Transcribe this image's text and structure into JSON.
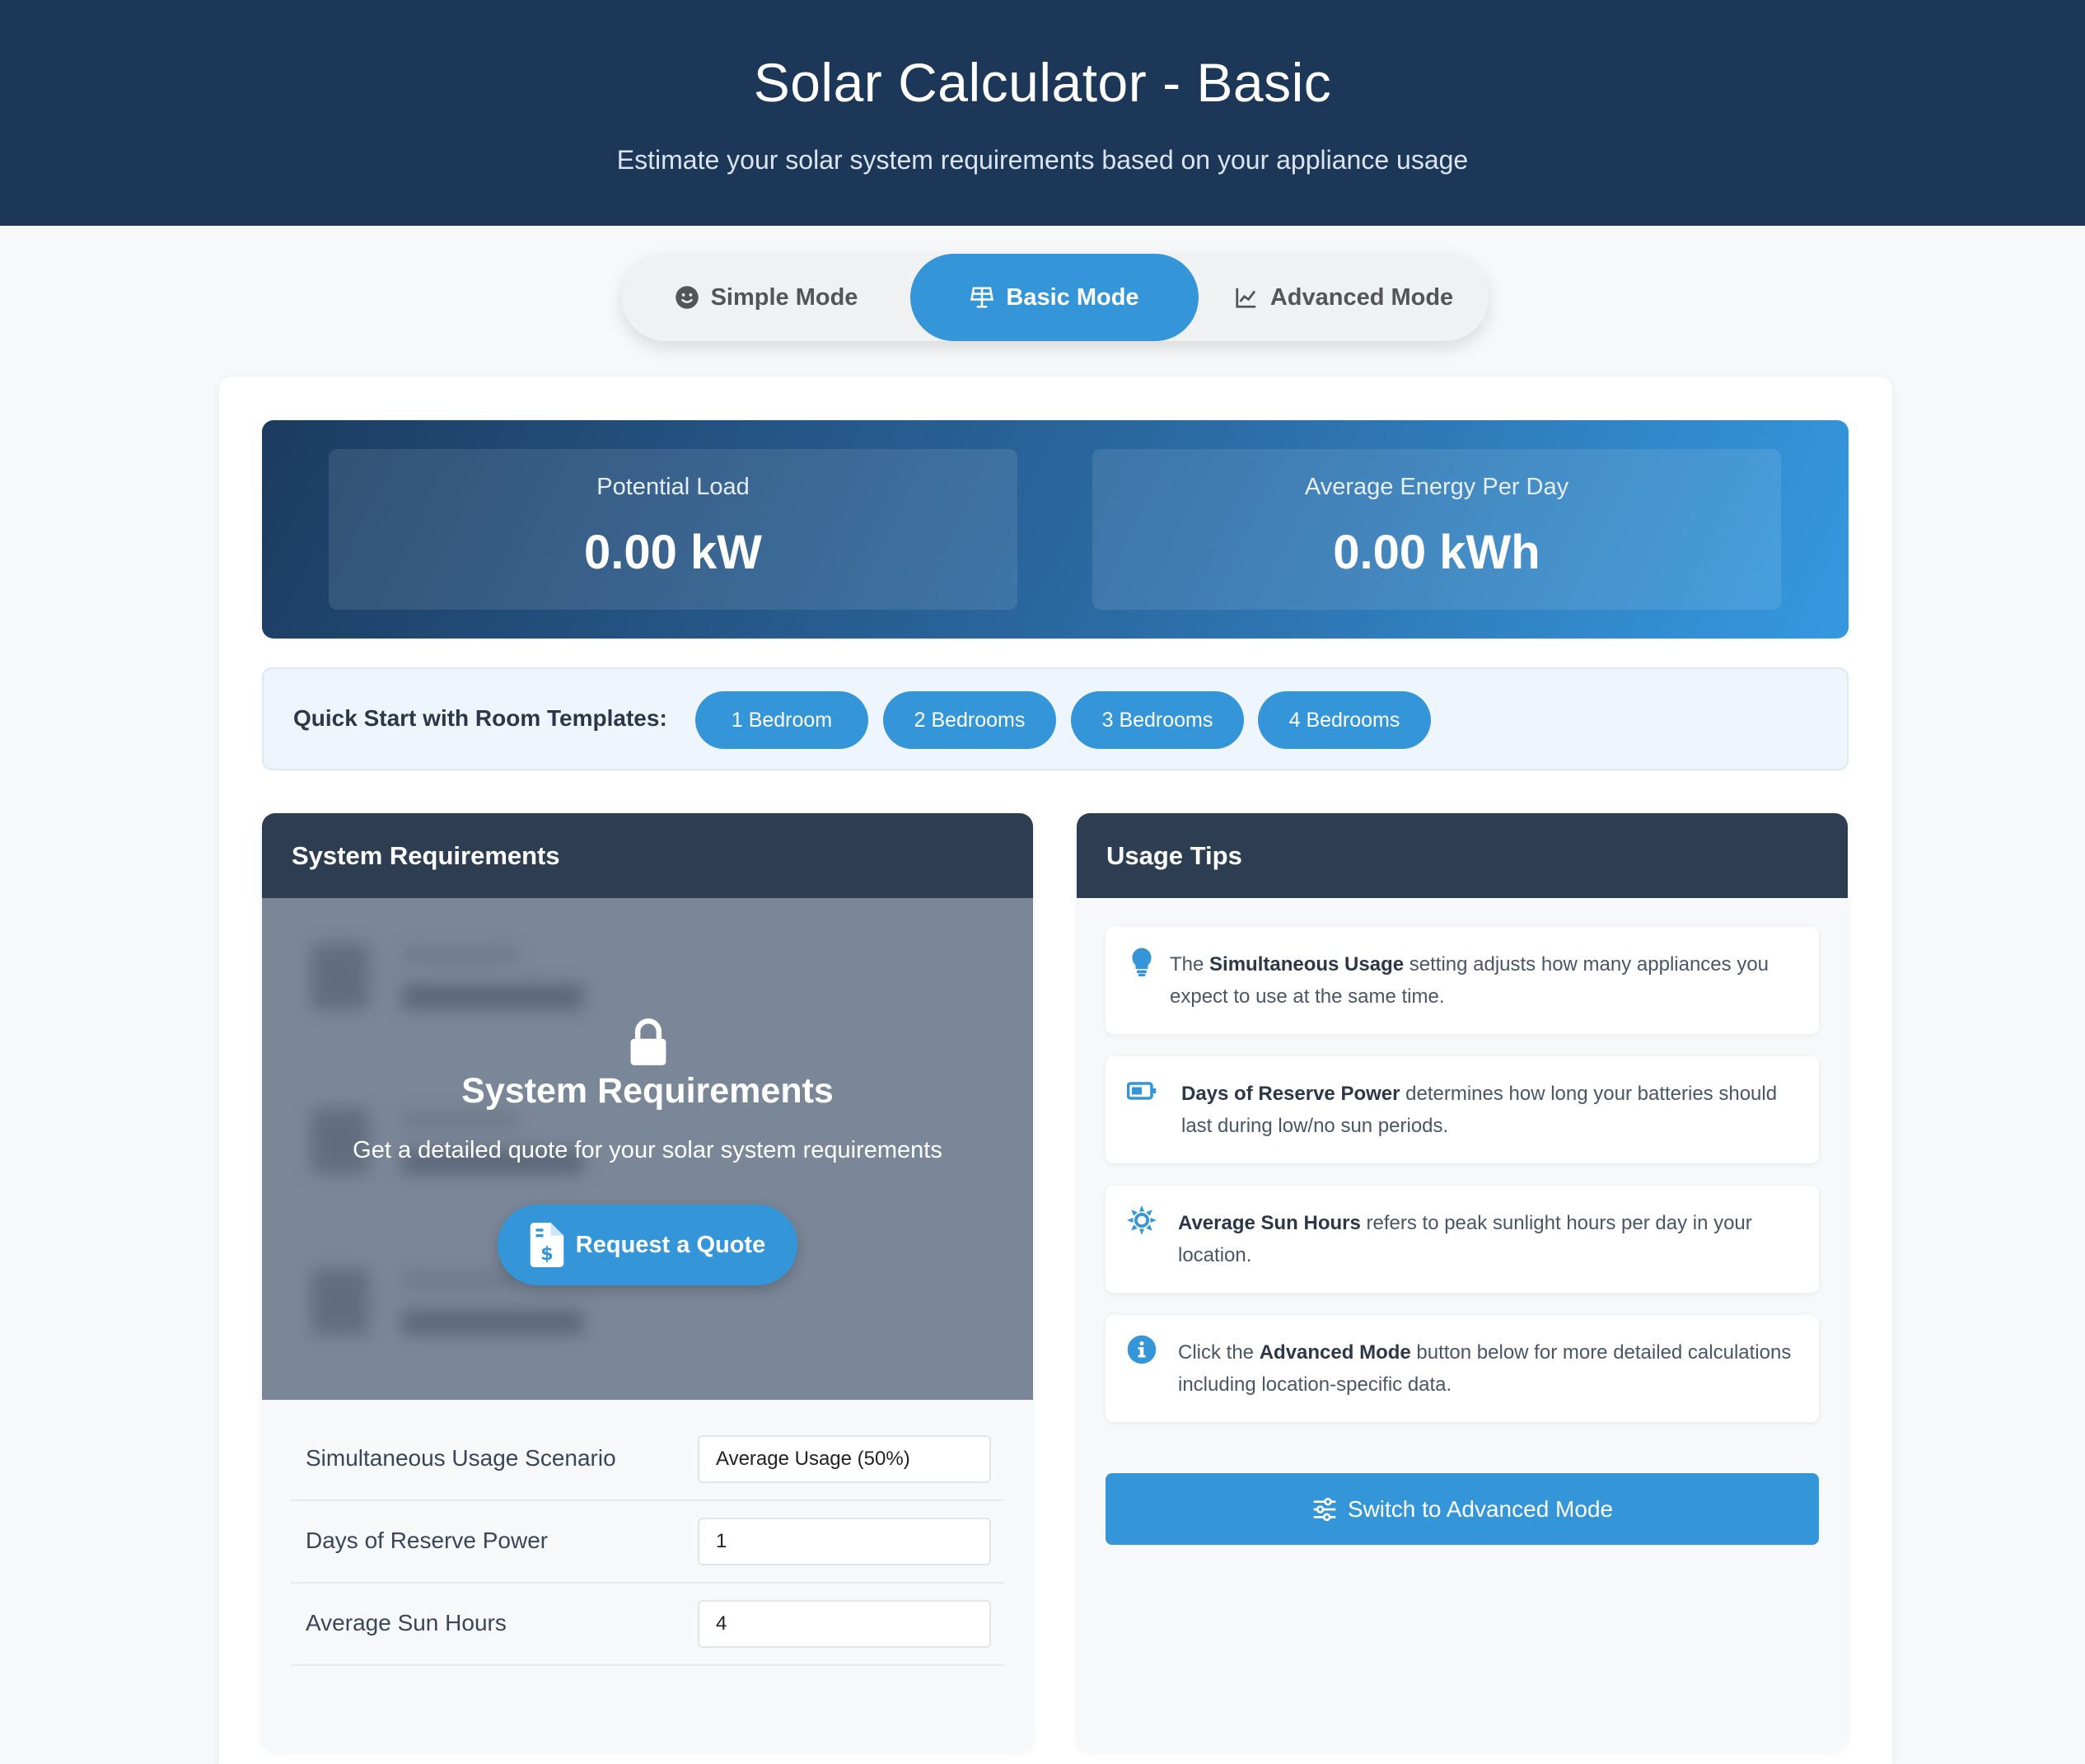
{
  "header": {
    "title": "Solar Calculator - Basic",
    "subtitle": "Estimate your solar system requirements based on your appliance usage"
  },
  "modes": {
    "simple": "Simple Mode",
    "basic": "Basic Mode",
    "advanced": "Advanced Mode",
    "active": "basic"
  },
  "stats": {
    "load_label": "Potential Load",
    "load_value": "0.00 kW",
    "energy_label": "Average Energy Per Day",
    "energy_value": "0.00 kWh"
  },
  "templates": {
    "label": "Quick Start with Room Templates:",
    "items": [
      "1 Bedroom",
      "2 Bedrooms",
      "3 Bedrooms",
      "4 Bedrooms"
    ]
  },
  "system": {
    "panel_title": "System Requirements",
    "locked_title": "System Requirements",
    "locked_text": "Get a detailed quote for your solar system requirements",
    "quote_button": "Request a Quote",
    "fields": [
      {
        "label": "Simultaneous Usage Scenario",
        "value": "Average Usage (50%)"
      },
      {
        "label": "Days of Reserve Power",
        "value": "1"
      },
      {
        "label": "Average Sun Hours",
        "value": "4"
      }
    ]
  },
  "tips": {
    "panel_title": "Usage Tips",
    "items": [
      {
        "icon": "lightbulb-icon",
        "pre": "The ",
        "bold": "Simultaneous Usage",
        "post": " setting adjusts how many appliances you expect to use at the same time."
      },
      {
        "icon": "battery-icon",
        "pre": "",
        "bold": "Days of Reserve Power",
        "post": " determines how long your batteries should last during low/no sun periods."
      },
      {
        "icon": "sun-icon",
        "pre": "",
        "bold": "Average Sun Hours",
        "post": " refers to peak sunlight hours per day in your location."
      },
      {
        "icon": "info-icon",
        "pre": "Click the ",
        "bold": "Advanced Mode",
        "post": " button below for more detailed calculations including location-specific data."
      }
    ],
    "advanced_button": "Switch to Advanced Mode"
  },
  "colors": {
    "header_bg": "#1c3757",
    "accent": "#3595d9",
    "panel_head": "#2d3e52"
  }
}
